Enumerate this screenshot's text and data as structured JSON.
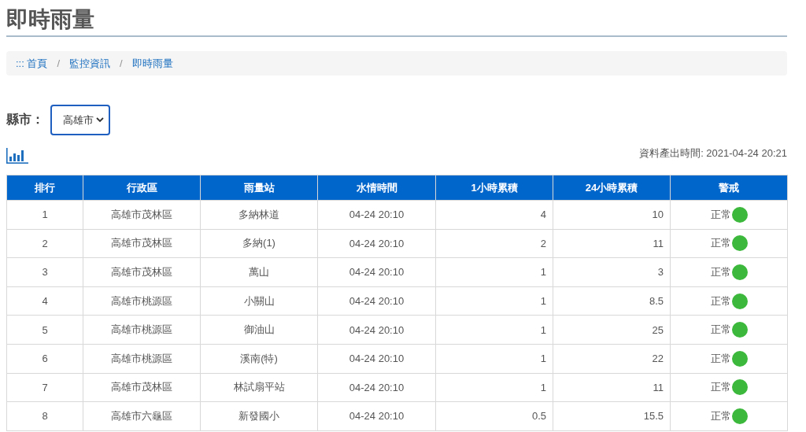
{
  "page_title": "即時雨量",
  "breadcrumb_separator": "/",
  "breadcrumb": [
    {
      "label": "::: 首頁"
    },
    {
      "label": "監控資訊"
    },
    {
      "label": "即時雨量"
    }
  ],
  "filter": {
    "label": "縣市：",
    "value": "高雄市"
  },
  "timestamp": "資料產出時間: 2021-04-24 20:21",
  "table": {
    "columns": [
      "排行",
      "行政區",
      "雨量站",
      "水情時間",
      "1小時累積",
      "24小時累積",
      "警戒"
    ],
    "rows": [
      {
        "rank": "1",
        "district": "高雄市茂林區",
        "station": "多納林道",
        "time": "04-24 20:10",
        "h1": "4",
        "h24": "10",
        "alert": "正常",
        "color": "#3cb93c"
      },
      {
        "rank": "2",
        "district": "高雄市茂林區",
        "station": "多納(1)",
        "time": "04-24 20:10",
        "h1": "2",
        "h24": "11",
        "alert": "正常",
        "color": "#3cb93c"
      },
      {
        "rank": "3",
        "district": "高雄市茂林區",
        "station": "萬山",
        "time": "04-24 20:10",
        "h1": "1",
        "h24": "3",
        "alert": "正常",
        "color": "#3cb93c"
      },
      {
        "rank": "4",
        "district": "高雄市桃源區",
        "station": "小關山",
        "time": "04-24 20:10",
        "h1": "1",
        "h24": "8.5",
        "alert": "正常",
        "color": "#3cb93c"
      },
      {
        "rank": "5",
        "district": "高雄市桃源區",
        "station": "御油山",
        "time": "04-24 20:10",
        "h1": "1",
        "h24": "25",
        "alert": "正常",
        "color": "#3cb93c"
      },
      {
        "rank": "6",
        "district": "高雄市桃源區",
        "station": "溪南(特)",
        "time": "04-24 20:10",
        "h1": "1",
        "h24": "22",
        "alert": "正常",
        "color": "#3cb93c"
      },
      {
        "rank": "7",
        "district": "高雄市茂林區",
        "station": "林試扇平站",
        "time": "04-24 20:10",
        "h1": "1",
        "h24": "11",
        "alert": "正常",
        "color": "#3cb93c"
      },
      {
        "rank": "8",
        "district": "高雄市六龜區",
        "station": "新發國小",
        "time": "04-24 20:10",
        "h1": "0.5",
        "h24": "15.5",
        "alert": "正常",
        "color": "#3cb93c"
      }
    ]
  }
}
